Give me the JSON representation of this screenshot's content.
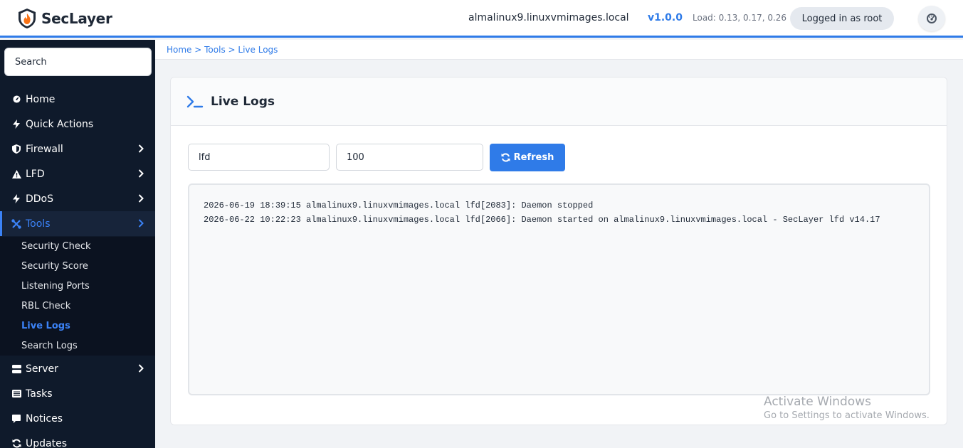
{
  "header": {
    "brand": "SecLayer",
    "hostname": "almalinux9.linuxvmimages.local",
    "version": "v1.0.0",
    "load": "Load: 0.13, 0.17, 0.26",
    "user_badge": "Logged in as root"
  },
  "colors": {
    "accent": "#2f7be8",
    "sidebar_bg": "#0f1a2b",
    "logo_orange": "#f97316"
  },
  "sidebar": {
    "search_placeholder": "Search",
    "items": [
      {
        "label": "Home",
        "icon": "dashboard-icon"
      },
      {
        "label": "Quick Actions",
        "icon": "bolt-icon"
      },
      {
        "label": "Firewall",
        "icon": "shield-icon",
        "has_children": true
      },
      {
        "label": "LFD",
        "icon": "warning-icon",
        "has_children": true
      },
      {
        "label": "DDoS",
        "icon": "bolt-icon",
        "has_children": true
      },
      {
        "label": "Tools",
        "icon": "tools-icon",
        "has_children": true,
        "active": true
      },
      {
        "label": "Server",
        "icon": "server-icon",
        "has_children": true
      },
      {
        "label": "Tasks",
        "icon": "list-icon"
      },
      {
        "label": "Notices",
        "icon": "comment-icon"
      },
      {
        "label": "Updates",
        "icon": "sync-icon"
      }
    ],
    "tools_submenu": [
      "Security Check",
      "Security Score",
      "Listening Ports",
      "RBL Check",
      "Live Logs",
      "Search Logs"
    ],
    "current_submenu": "Live Logs"
  },
  "breadcrumb": [
    "Home",
    "Tools",
    "Live Logs"
  ],
  "page": {
    "title": "Live Logs",
    "log_source_value": "lfd",
    "line_count_value": "100",
    "refresh_label": "Refresh",
    "log_lines": [
      "2026-06-19 18:39:15 almalinux9.linuxvmimages.local lfd[2083]: Daemon stopped",
      "2026-06-22 10:22:23 almalinux9.linuxvmimages.local lfd[2066]: Daemon started on almalinux9.linuxvmimages.local - SecLayer lfd v14.17"
    ]
  },
  "watermark": {
    "line1": "Activate Windows",
    "line2": "Go to Settings to activate Windows."
  }
}
